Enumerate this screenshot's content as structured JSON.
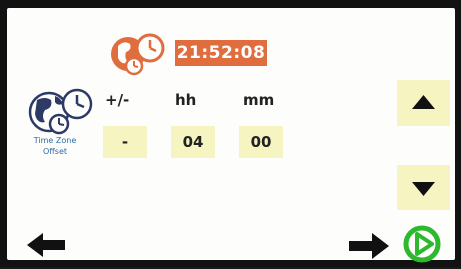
{
  "clock": {
    "time": "21:52:08",
    "icon": "clock-world-icon",
    "color": "#e06d3e"
  },
  "timezone": {
    "icon": "globe-clock-icon",
    "label_line1": "Time Zone",
    "label_line2": "Offset",
    "label_color": "#2d6aa8"
  },
  "columns": {
    "sign": "+/-",
    "hours": "hh",
    "minutes": "mm"
  },
  "values": {
    "sign": "-",
    "hours": "04",
    "minutes": "00",
    "field_color": "#f6f5c2"
  },
  "controls": {
    "up_icon": "triangle-up-icon",
    "down_icon": "triangle-down-icon",
    "back_icon": "arrow-left-icon",
    "next_icon": "arrow-right-icon",
    "confirm_icon": "play-circle-icon",
    "confirm_color": "#2eb82e"
  }
}
